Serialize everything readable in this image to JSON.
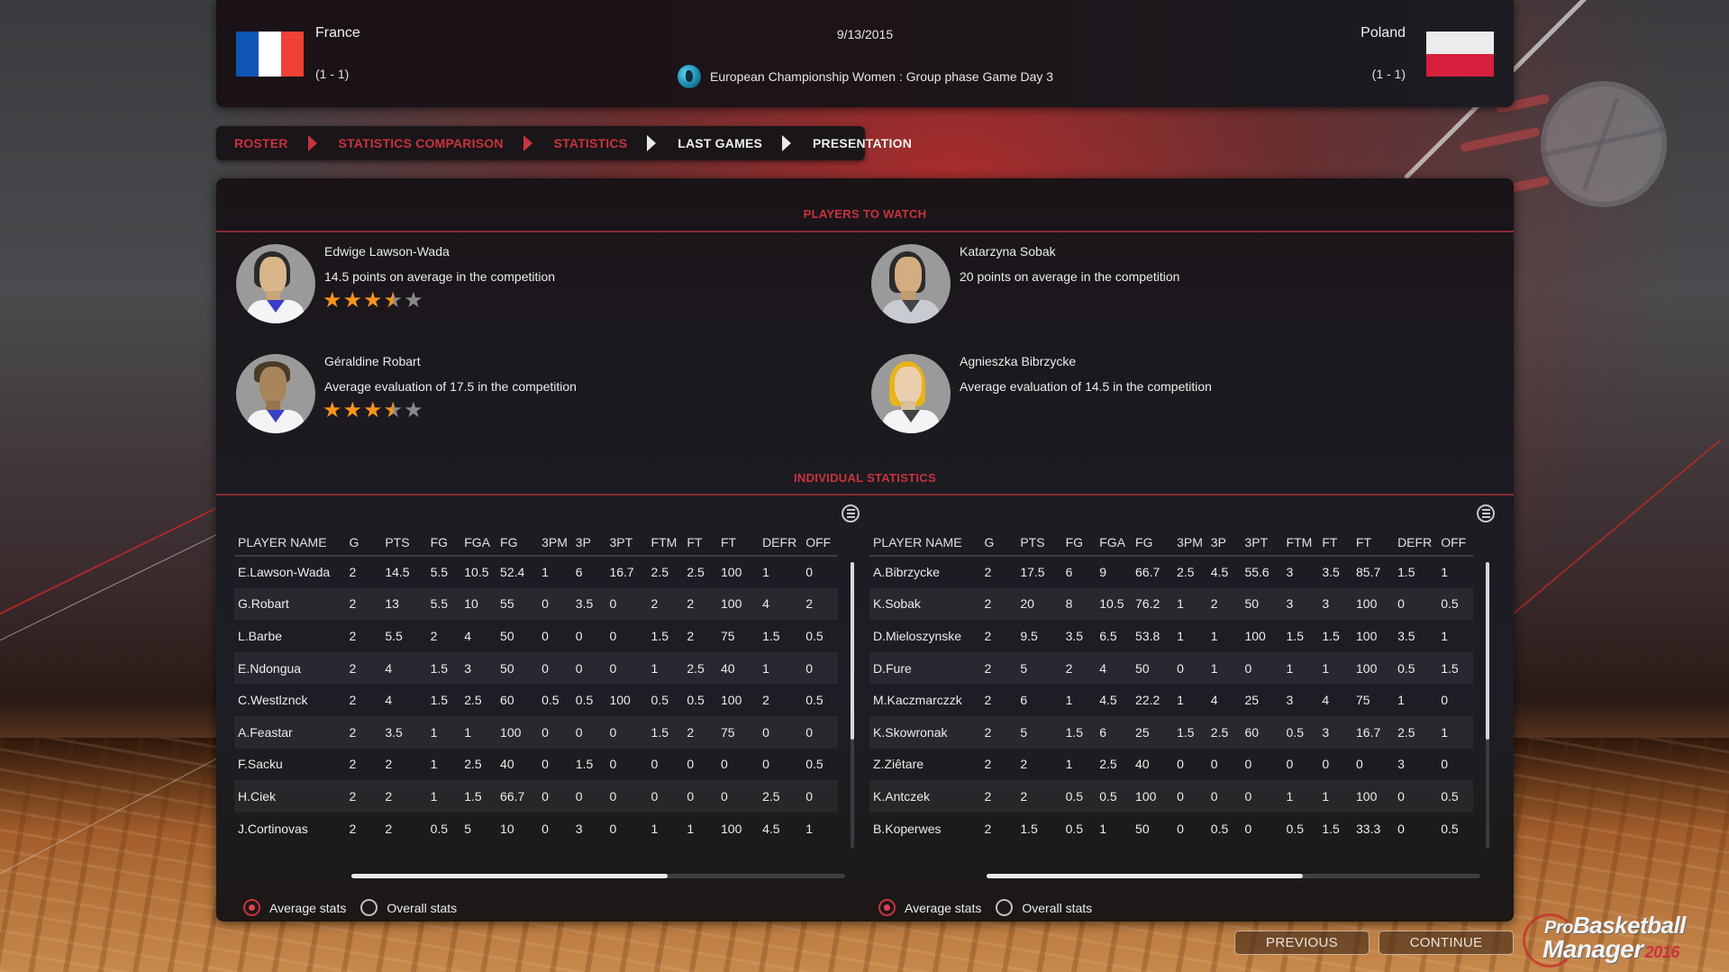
{
  "match": {
    "date": "9/13/2015",
    "competition": "European Championship Women : Group phase  Game Day 3",
    "competition_icon": "globe-europe-icon",
    "home": {
      "name": "France",
      "record": "(1 - 1)",
      "flag": "france-flag"
    },
    "away": {
      "name": "Poland",
      "record": "(1 - 1)",
      "flag": "poland-flag"
    }
  },
  "breadcrumb": [
    {
      "label": "ROSTER",
      "state": "visited"
    },
    {
      "label": "STATISTICS COMPARISON",
      "state": "visited"
    },
    {
      "label": "STATISTICS",
      "state": "visited"
    },
    {
      "label": "LAST GAMES",
      "state": "upcoming"
    },
    {
      "label": "PRESENTATION",
      "state": "current"
    }
  ],
  "players_to_watch": {
    "title": "PLAYERS TO WATCH",
    "home": [
      {
        "name": "Edwige Lawson-Wada",
        "description": "14.5 points on average in the competition",
        "rating": 3.5,
        "rating_max": 5
      },
      {
        "name": "Géraldine Robart",
        "description": "Average evaluation of 17.5 in the competition",
        "rating": 3.5,
        "rating_max": 5
      }
    ],
    "away": [
      {
        "name": "Katarzyna Sobak",
        "description": "20 points on average in the competition"
      },
      {
        "name": "Agnieszka Bibrzycke",
        "description": "Average evaluation of 14.5 in the competition"
      }
    ]
  },
  "individual_statistics": {
    "title": "INDIVIDUAL STATISTICS",
    "columns": [
      "PLAYER NAME",
      "G",
      "PTS",
      "FG",
      "FGA",
      "FG",
      "3PM",
      "3P",
      "3PT",
      "FTM",
      "FT",
      "FT",
      "DEFR",
      "OFF"
    ],
    "home": {
      "rows": [
        [
          "E.Lawson-Wada",
          "2",
          "14.5",
          "5.5",
          "10.5",
          "52.4",
          "1",
          "6",
          "16.7",
          "2.5",
          "2.5",
          "100",
          "1",
          "0"
        ],
        [
          "G.Robart",
          "2",
          "13",
          "5.5",
          "10",
          "55",
          "0",
          "3.5",
          "0",
          "2",
          "2",
          "100",
          "4",
          "2"
        ],
        [
          "L.Barbe",
          "2",
          "5.5",
          "2",
          "4",
          "50",
          "0",
          "0",
          "0",
          "1.5",
          "2",
          "75",
          "1.5",
          "0.5"
        ],
        [
          "E.Ndongua",
          "2",
          "4",
          "1.5",
          "3",
          "50",
          "0",
          "0",
          "0",
          "1",
          "2.5",
          "40",
          "1",
          "0"
        ],
        [
          "C.Westlznck",
          "2",
          "4",
          "1.5",
          "2.5",
          "60",
          "0.5",
          "0.5",
          "100",
          "0.5",
          "0.5",
          "100",
          "2",
          "0.5"
        ],
        [
          "A.Feastar",
          "2",
          "3.5",
          "1",
          "1",
          "100",
          "0",
          "0",
          "0",
          "1.5",
          "2",
          "75",
          "0",
          "0"
        ],
        [
          "F.Sacku",
          "2",
          "2",
          "1",
          "2.5",
          "40",
          "0",
          "1.5",
          "0",
          "0",
          "0",
          "0",
          "0",
          "0.5"
        ],
        [
          "H.Ciek",
          "2",
          "2",
          "1",
          "1.5",
          "66.7",
          "0",
          "0",
          "0",
          "0",
          "0",
          "0",
          "2.5",
          "0"
        ],
        [
          "J.Cortinovas",
          "2",
          "2",
          "0.5",
          "5",
          "10",
          "0",
          "3",
          "0",
          "1",
          "1",
          "100",
          "4.5",
          "1"
        ]
      ],
      "vertical_scroll_fraction": 0.62,
      "horizontal_scroll_fraction": 0.64,
      "stat_mode": "average"
    },
    "away": {
      "rows": [
        [
          "A.Bibrzycke",
          "2",
          "17.5",
          "6",
          "9",
          "66.7",
          "2.5",
          "4.5",
          "55.6",
          "3",
          "3.5",
          "85.7",
          "1.5",
          "1"
        ],
        [
          "K.Sobak",
          "2",
          "20",
          "8",
          "10.5",
          "76.2",
          "1",
          "2",
          "50",
          "3",
          "3",
          "100",
          "0",
          "0.5"
        ],
        [
          "D.Mieloszynske",
          "2",
          "9.5",
          "3.5",
          "6.5",
          "53.8",
          "1",
          "1",
          "100",
          "1.5",
          "1.5",
          "100",
          "3.5",
          "1"
        ],
        [
          "D.Fure",
          "2",
          "5",
          "2",
          "4",
          "50",
          "0",
          "1",
          "0",
          "1",
          "1",
          "100",
          "0.5",
          "1.5"
        ],
        [
          "M.Kaczmarczzk",
          "2",
          "6",
          "1",
          "4.5",
          "22.2",
          "1",
          "4",
          "25",
          "3",
          "4",
          "75",
          "1",
          "0"
        ],
        [
          "K.Skowronak",
          "2",
          "5",
          "1.5",
          "6",
          "25",
          "1.5",
          "2.5",
          "60",
          "0.5",
          "3",
          "16.7",
          "2.5",
          "1"
        ],
        [
          "Z.Ziêtare",
          "2",
          "2",
          "1",
          "2.5",
          "40",
          "0",
          "0",
          "0",
          "0",
          "0",
          "0",
          "3",
          "0"
        ],
        [
          "K.Antczek",
          "2",
          "2",
          "0.5",
          "0.5",
          "100",
          "0",
          "0",
          "0",
          "1",
          "1",
          "100",
          "0",
          "0.5"
        ],
        [
          "B.Koperwes",
          "2",
          "1.5",
          "0.5",
          "1",
          "50",
          "0",
          "0.5",
          "0",
          "0.5",
          "1.5",
          "33.3",
          "0",
          "0.5"
        ]
      ],
      "vertical_scroll_fraction": 0.62,
      "horizontal_scroll_fraction": 0.64,
      "stat_mode": "average"
    },
    "radio_options": {
      "average": "Average stats",
      "overall": "Overall stats"
    },
    "menu_icon": "list-menu-icon"
  },
  "footer": {
    "previous_label": "PREVIOUS",
    "continue_label": "CONTINUE",
    "logo": {
      "line1_prefix": "Pro",
      "line1": "Basketball",
      "line2": "Manager",
      "year": "2016"
    }
  },
  "colors": {
    "accent_red": "#c9333d",
    "star_orange": "#f7941d",
    "panel_dark": "#1c1b22"
  }
}
